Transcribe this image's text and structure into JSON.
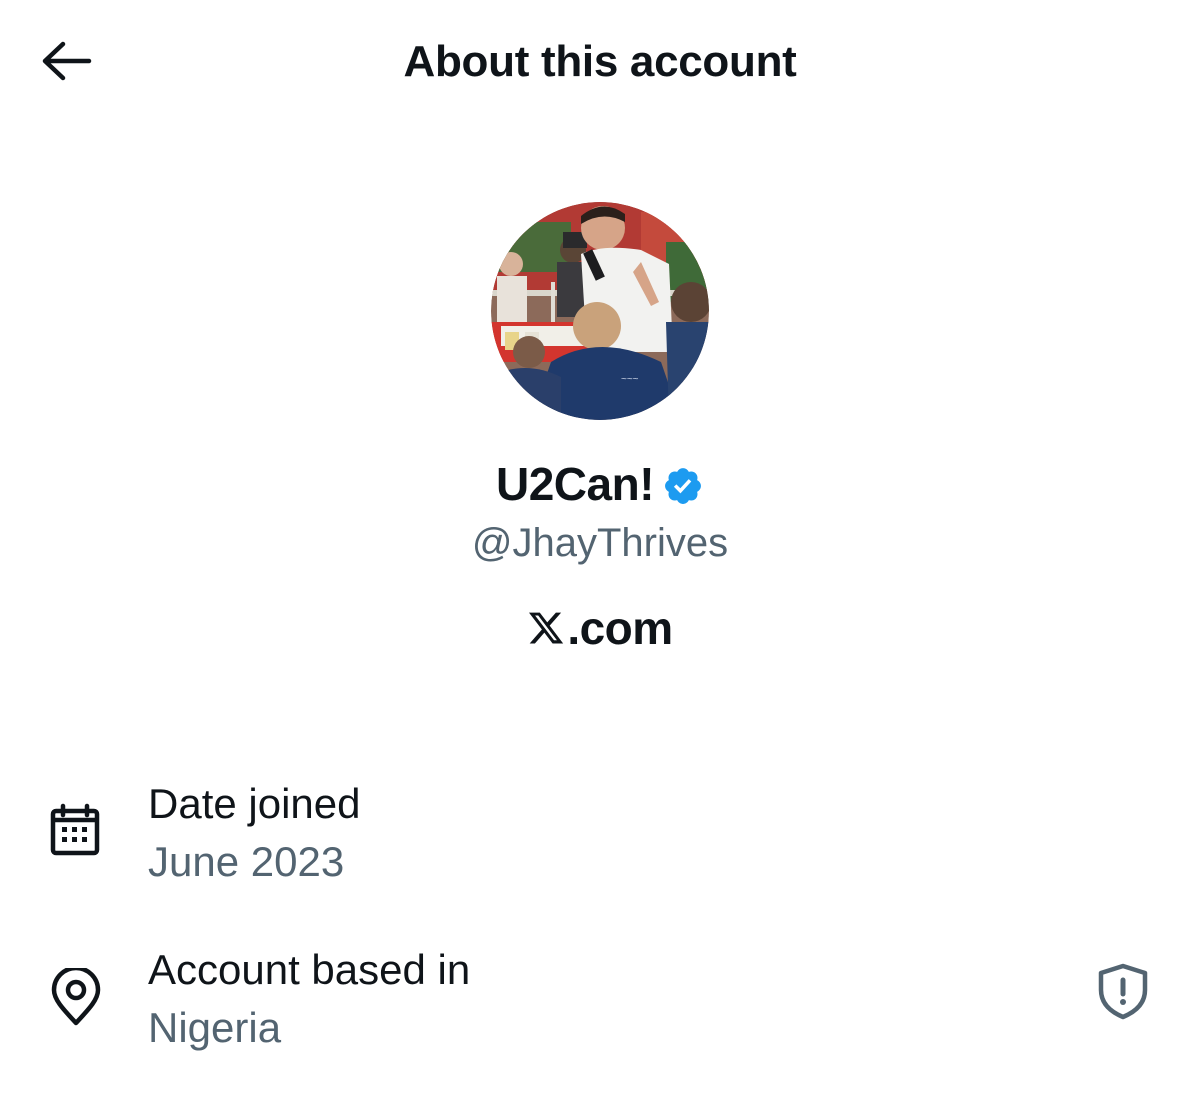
{
  "header": {
    "title": "About this account",
    "back_icon": "arrow-left-icon"
  },
  "profile": {
    "display_name": "U2Can!",
    "handle": "@JhayThrives",
    "verified": true,
    "verified_color": "#1d9bf0",
    "avatar_icon": "profile-photo",
    "platform_logo_icon": "x-logo-icon",
    "platform_text": ".com"
  },
  "details": {
    "date_joined": {
      "label": "Date joined",
      "value": "June 2023",
      "icon": "calendar-icon"
    },
    "account_based_in": {
      "label": "Account based in",
      "value": "Nigeria",
      "icon": "location-pin-icon",
      "action_icon": "shield-alert-icon"
    }
  },
  "colors": {
    "primary_text": "#0f1419",
    "secondary_text": "#536471",
    "shield_icon": "#536471"
  }
}
